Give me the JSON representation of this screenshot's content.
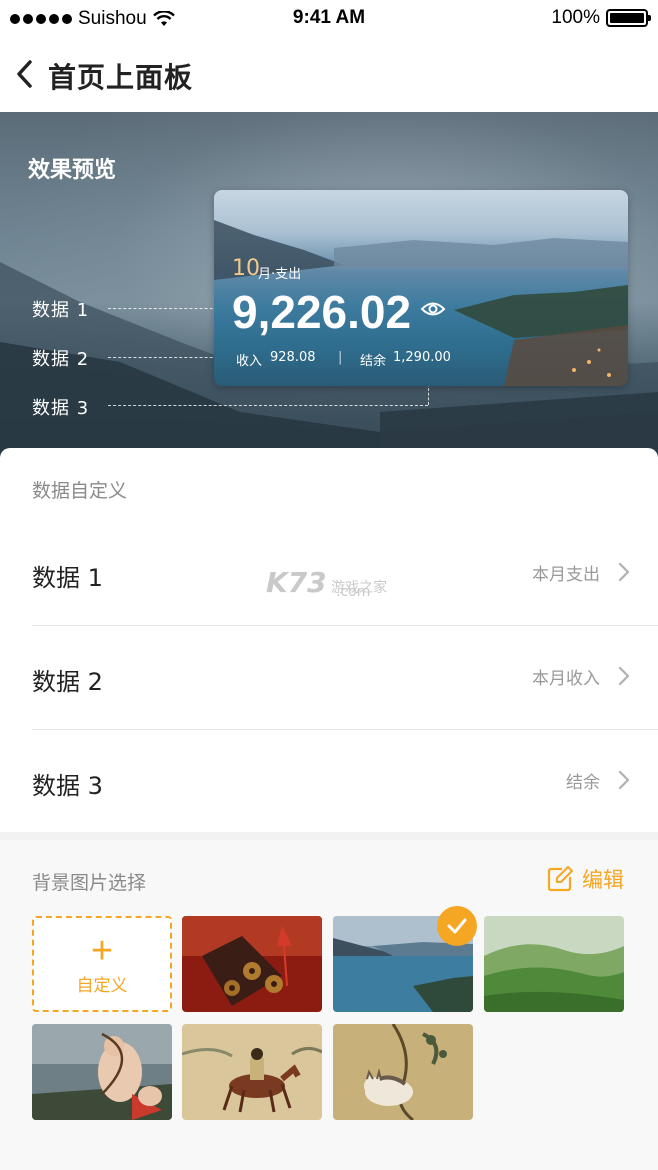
{
  "status_bar": {
    "carrier": "Suishou",
    "time": "9:41 AM",
    "battery": "100%"
  },
  "nav": {
    "title": "首页上面板"
  },
  "preview": {
    "title": "效果预览",
    "labels": [
      "数据  1",
      "数据  2",
      "数据  3"
    ],
    "card": {
      "month_number": "10",
      "month_suffix": "月·支出",
      "amount": "9,226.02",
      "income_label": "收入",
      "income_value": "928.08",
      "separator": "|",
      "balance_label": "结余",
      "balance_value": "1,290.00"
    }
  },
  "data_custom": {
    "title": "数据自定义",
    "rows": [
      {
        "label": "数据 1",
        "value": "本月支出"
      },
      {
        "label": "数据 2",
        "value": "本月收入"
      },
      {
        "label": "数据 3",
        "value": "结余"
      }
    ]
  },
  "watermark": {
    "brand": "K73",
    "sub1": "游戏之家",
    "sub2": ".com"
  },
  "background": {
    "title": "背景图片选择",
    "edit_label": "编辑",
    "custom_label": "自定义",
    "thumbnails": [
      {
        "name": "chinese-knot-coins",
        "selected": false
      },
      {
        "name": "lake-mountains",
        "selected": true
      },
      {
        "name": "green-hills",
        "selected": false
      },
      {
        "name": "classical-painting-cupid",
        "selected": false
      },
      {
        "name": "horse-rider-painting",
        "selected": false
      },
      {
        "name": "cat-painting",
        "selected": false
      }
    ]
  },
  "colors": {
    "accent": "#f5a623",
    "muted_text": "#999999"
  }
}
